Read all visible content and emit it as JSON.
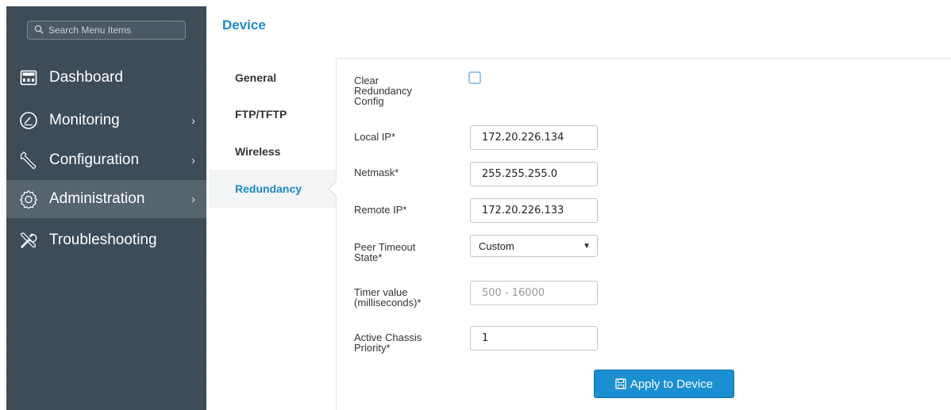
{
  "search": {
    "placeholder": "Search Menu Items",
    "icon": "search-icon"
  },
  "sidebar": {
    "items": [
      {
        "label": "Dashboard",
        "icon": "dashboard-icon",
        "has_submenu": false,
        "active": false
      },
      {
        "label": "Monitoring",
        "icon": "gauge-icon",
        "has_submenu": true,
        "active": false
      },
      {
        "label": "Configuration",
        "icon": "wrench-icon",
        "has_submenu": true,
        "active": false
      },
      {
        "label": "Administration",
        "icon": "gear-icon",
        "has_submenu": true,
        "active": true
      },
      {
        "label": "Troubleshooting",
        "icon": "tools-icon",
        "has_submenu": false,
        "active": false
      }
    ],
    "chevron": "›"
  },
  "header": {
    "title": "Device"
  },
  "subnav": {
    "items": [
      {
        "label": "General",
        "active": false
      },
      {
        "label": "FTP/TFTP",
        "active": false
      },
      {
        "label": "Wireless",
        "active": false
      },
      {
        "label": "Redundancy",
        "active": true
      }
    ]
  },
  "form": {
    "clear_redundancy": {
      "label_1": "Clear",
      "label_2": "Redundancy",
      "label_3": "Config",
      "checked": false
    },
    "local_ip": {
      "label": "Local IP*",
      "value": "172.20.226.134"
    },
    "netmask": {
      "label": "Netmask*",
      "value": "255.255.255.0"
    },
    "remote_ip": {
      "label": "Remote IP*",
      "value": "172.20.226.133"
    },
    "peer_timeout": {
      "label_1": "Peer Timeout",
      "label_2": "State*",
      "value": "Custom",
      "caret": "▼"
    },
    "timer_value": {
      "label_1": "Timer value",
      "label_2": "(milliseconds)*",
      "value": "",
      "placeholder": "500 - 16000"
    },
    "chassis_priority": {
      "label_1": "Active Chassis",
      "label_2": "Priority*",
      "value": "1"
    },
    "apply_button": {
      "label": "Apply to Device",
      "icon": "save-icon"
    }
  },
  "colors": {
    "sidebar_bg": "#3b4a55",
    "accent": "#1e8ac7",
    "button": "#1a8fd1"
  }
}
